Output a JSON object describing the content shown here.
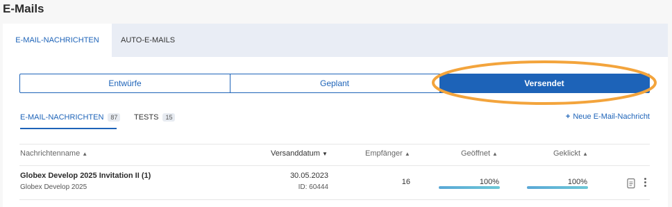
{
  "page": {
    "title": "E-Mails"
  },
  "tabs": {
    "emails": "E-MAIL-NACHRICHTEN",
    "auto": "AUTO-E-MAILS"
  },
  "segments": {
    "drafts": "Entwürfe",
    "planned": "Geplant",
    "sent": "Versendet"
  },
  "subtabs": {
    "emails_label": "E-MAIL-NACHRICHTEN",
    "emails_count": "87",
    "tests_label": "TESTS",
    "tests_count": "15"
  },
  "new_message": {
    "plus": "+",
    "label": "Neue E-Mail-Nachricht"
  },
  "table": {
    "headers": {
      "name": "Nachrichtenname",
      "date": "Versanddatum",
      "recipients": "Empfänger",
      "opened": "Geöffnet",
      "clicked": "Geklickt"
    },
    "arrows": {
      "up": "▲",
      "down": "▼"
    },
    "rows": [
      {
        "name": "Globex Develop 2025 Invitation II (1)",
        "subtitle": "Globex Develop 2025",
        "date": "30.05.2023",
        "id": "ID: 60444",
        "recipients": "16",
        "opened": "100%",
        "opened_fraction": 1.0,
        "clicked": "100%",
        "clicked_fraction": 1.0
      }
    ]
  },
  "colors": {
    "accent": "#1d63b8",
    "highlight": "#f3a43c"
  },
  "icons": {
    "document": "document-icon",
    "more": "more-vertical-icon"
  }
}
